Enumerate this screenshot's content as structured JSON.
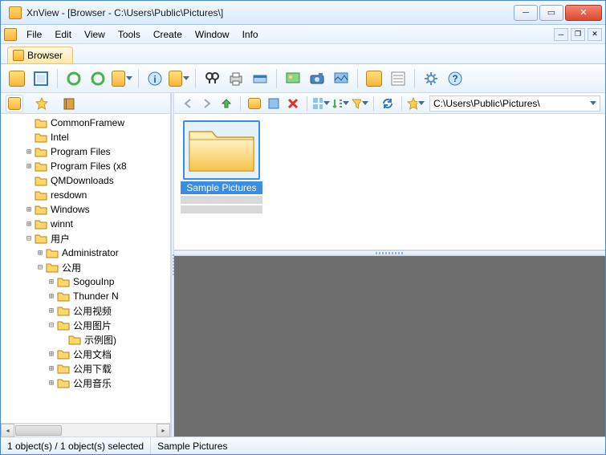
{
  "window": {
    "title": "XnView - [Browser - C:\\Users\\Public\\Pictures\\]"
  },
  "menu": {
    "file": "File",
    "edit": "Edit",
    "view": "View",
    "tools": "Tools",
    "create": "Create",
    "window": "Window",
    "info": "Info"
  },
  "tab": {
    "browser": "Browser"
  },
  "address": {
    "path": "C:\\Users\\Public\\Pictures\\"
  },
  "tree": {
    "items": [
      {
        "ind": 2,
        "tw": "",
        "label": "CommonFramew"
      },
      {
        "ind": 2,
        "tw": "",
        "label": "Intel"
      },
      {
        "ind": 2,
        "tw": "+",
        "label": "Program Files"
      },
      {
        "ind": 2,
        "tw": "+",
        "label": "Program Files (x8"
      },
      {
        "ind": 2,
        "tw": "",
        "label": "QMDownloads"
      },
      {
        "ind": 2,
        "tw": "",
        "label": "resdown"
      },
      {
        "ind": 2,
        "tw": "+",
        "label": "Windows"
      },
      {
        "ind": 2,
        "tw": "+",
        "label": "winnt"
      },
      {
        "ind": 2,
        "tw": "-",
        "label": "用户"
      },
      {
        "ind": 3,
        "tw": "+",
        "label": "Administrator"
      },
      {
        "ind": 3,
        "tw": "-",
        "label": "公用"
      },
      {
        "ind": 4,
        "tw": "+",
        "label": "SogouInp"
      },
      {
        "ind": 4,
        "tw": "+",
        "label": "Thunder N"
      },
      {
        "ind": 4,
        "tw": "+",
        "label": "公用视频"
      },
      {
        "ind": 4,
        "tw": "-",
        "label": "公用图片"
      },
      {
        "ind": 5,
        "tw": "",
        "label": "示例图)"
      },
      {
        "ind": 4,
        "tw": "+",
        "label": "公用文档"
      },
      {
        "ind": 4,
        "tw": "+",
        "label": "公用下载"
      },
      {
        "ind": 4,
        "tw": "+",
        "label": "公用音乐"
      }
    ]
  },
  "thumb": {
    "label": "Sample Pictures"
  },
  "status": {
    "count": "1 object(s) / 1 object(s) selected",
    "name": "Sample Pictures"
  },
  "icons": {
    "folder_small": "<path d='M1 3h5l1.5 2H15v8H1z' fill='#ffd76b' stroke='#b5831a'/>",
    "folder_big": "<path d='M4 10h28l6 7h46v42H4z' fill='url(#fg)' stroke='#c69a2e' stroke-width='1.5'/><path d='M4 18h80' stroke='#e6b856'/>"
  }
}
